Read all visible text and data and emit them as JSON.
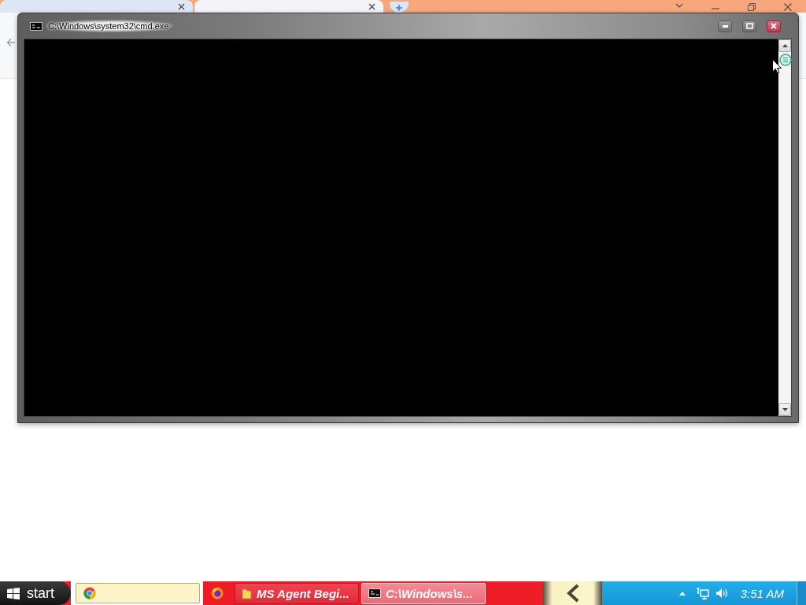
{
  "window": {
    "title": "C:\\Windows\\system32\\cmd.exe"
  },
  "taskbar": {
    "start": "start",
    "tasks": [
      {
        "label": "MS Agent Begi...",
        "selected": false
      },
      {
        "label": "C:\\Windows\\s...",
        "selected": true
      }
    ],
    "clock": "3:51 AM"
  }
}
